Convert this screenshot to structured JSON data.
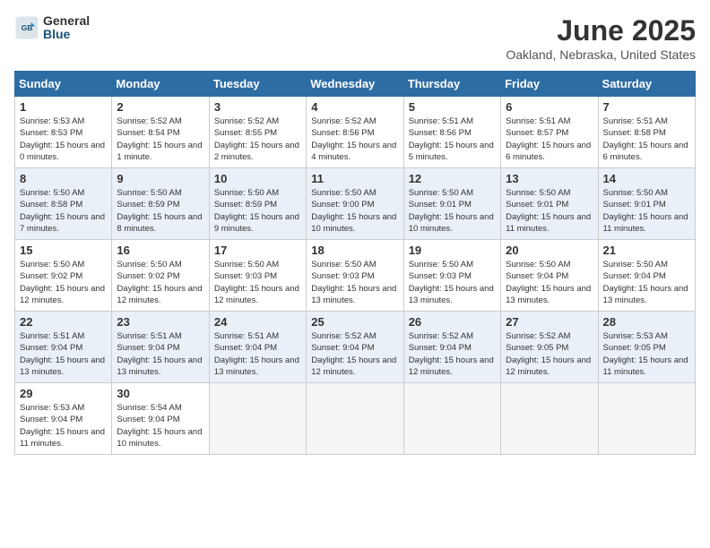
{
  "logo": {
    "general": "General",
    "blue": "Blue"
  },
  "title": "June 2025",
  "location": "Oakland, Nebraska, United States",
  "weekdays": [
    "Sunday",
    "Monday",
    "Tuesday",
    "Wednesday",
    "Thursday",
    "Friday",
    "Saturday"
  ],
  "weeks": [
    [
      {
        "day": "1",
        "sunrise": "Sunrise: 5:53 AM",
        "sunset": "Sunset: 8:53 PM",
        "daylight": "Daylight: 15 hours and 0 minutes."
      },
      {
        "day": "2",
        "sunrise": "Sunrise: 5:52 AM",
        "sunset": "Sunset: 8:54 PM",
        "daylight": "Daylight: 15 hours and 1 minute."
      },
      {
        "day": "3",
        "sunrise": "Sunrise: 5:52 AM",
        "sunset": "Sunset: 8:55 PM",
        "daylight": "Daylight: 15 hours and 2 minutes."
      },
      {
        "day": "4",
        "sunrise": "Sunrise: 5:52 AM",
        "sunset": "Sunset: 8:56 PM",
        "daylight": "Daylight: 15 hours and 4 minutes."
      },
      {
        "day": "5",
        "sunrise": "Sunrise: 5:51 AM",
        "sunset": "Sunset: 8:56 PM",
        "daylight": "Daylight: 15 hours and 5 minutes."
      },
      {
        "day": "6",
        "sunrise": "Sunrise: 5:51 AM",
        "sunset": "Sunset: 8:57 PM",
        "daylight": "Daylight: 15 hours and 6 minutes."
      },
      {
        "day": "7",
        "sunrise": "Sunrise: 5:51 AM",
        "sunset": "Sunset: 8:58 PM",
        "daylight": "Daylight: 15 hours and 6 minutes."
      }
    ],
    [
      {
        "day": "8",
        "sunrise": "Sunrise: 5:50 AM",
        "sunset": "Sunset: 8:58 PM",
        "daylight": "Daylight: 15 hours and 7 minutes."
      },
      {
        "day": "9",
        "sunrise": "Sunrise: 5:50 AM",
        "sunset": "Sunset: 8:59 PM",
        "daylight": "Daylight: 15 hours and 8 minutes."
      },
      {
        "day": "10",
        "sunrise": "Sunrise: 5:50 AM",
        "sunset": "Sunset: 8:59 PM",
        "daylight": "Daylight: 15 hours and 9 minutes."
      },
      {
        "day": "11",
        "sunrise": "Sunrise: 5:50 AM",
        "sunset": "Sunset: 9:00 PM",
        "daylight": "Daylight: 15 hours and 10 minutes."
      },
      {
        "day": "12",
        "sunrise": "Sunrise: 5:50 AM",
        "sunset": "Sunset: 9:01 PM",
        "daylight": "Daylight: 15 hours and 10 minutes."
      },
      {
        "day": "13",
        "sunrise": "Sunrise: 5:50 AM",
        "sunset": "Sunset: 9:01 PM",
        "daylight": "Daylight: 15 hours and 11 minutes."
      },
      {
        "day": "14",
        "sunrise": "Sunrise: 5:50 AM",
        "sunset": "Sunset: 9:01 PM",
        "daylight": "Daylight: 15 hours and 11 minutes."
      }
    ],
    [
      {
        "day": "15",
        "sunrise": "Sunrise: 5:50 AM",
        "sunset": "Sunset: 9:02 PM",
        "daylight": "Daylight: 15 hours and 12 minutes."
      },
      {
        "day": "16",
        "sunrise": "Sunrise: 5:50 AM",
        "sunset": "Sunset: 9:02 PM",
        "daylight": "Daylight: 15 hours and 12 minutes."
      },
      {
        "day": "17",
        "sunrise": "Sunrise: 5:50 AM",
        "sunset": "Sunset: 9:03 PM",
        "daylight": "Daylight: 15 hours and 12 minutes."
      },
      {
        "day": "18",
        "sunrise": "Sunrise: 5:50 AM",
        "sunset": "Sunset: 9:03 PM",
        "daylight": "Daylight: 15 hours and 13 minutes."
      },
      {
        "day": "19",
        "sunrise": "Sunrise: 5:50 AM",
        "sunset": "Sunset: 9:03 PM",
        "daylight": "Daylight: 15 hours and 13 minutes."
      },
      {
        "day": "20",
        "sunrise": "Sunrise: 5:50 AM",
        "sunset": "Sunset: 9:04 PM",
        "daylight": "Daylight: 15 hours and 13 minutes."
      },
      {
        "day": "21",
        "sunrise": "Sunrise: 5:50 AM",
        "sunset": "Sunset: 9:04 PM",
        "daylight": "Daylight: 15 hours and 13 minutes."
      }
    ],
    [
      {
        "day": "22",
        "sunrise": "Sunrise: 5:51 AM",
        "sunset": "Sunset: 9:04 PM",
        "daylight": "Daylight: 15 hours and 13 minutes."
      },
      {
        "day": "23",
        "sunrise": "Sunrise: 5:51 AM",
        "sunset": "Sunset: 9:04 PM",
        "daylight": "Daylight: 15 hours and 13 minutes."
      },
      {
        "day": "24",
        "sunrise": "Sunrise: 5:51 AM",
        "sunset": "Sunset: 9:04 PM",
        "daylight": "Daylight: 15 hours and 13 minutes."
      },
      {
        "day": "25",
        "sunrise": "Sunrise: 5:52 AM",
        "sunset": "Sunset: 9:04 PM",
        "daylight": "Daylight: 15 hours and 12 minutes."
      },
      {
        "day": "26",
        "sunrise": "Sunrise: 5:52 AM",
        "sunset": "Sunset: 9:04 PM",
        "daylight": "Daylight: 15 hours and 12 minutes."
      },
      {
        "day": "27",
        "sunrise": "Sunrise: 5:52 AM",
        "sunset": "Sunset: 9:05 PM",
        "daylight": "Daylight: 15 hours and 12 minutes."
      },
      {
        "day": "28",
        "sunrise": "Sunrise: 5:53 AM",
        "sunset": "Sunset: 9:05 PM",
        "daylight": "Daylight: 15 hours and 11 minutes."
      }
    ],
    [
      {
        "day": "29",
        "sunrise": "Sunrise: 5:53 AM",
        "sunset": "Sunset: 9:04 PM",
        "daylight": "Daylight: 15 hours and 11 minutes."
      },
      {
        "day": "30",
        "sunrise": "Sunrise: 5:54 AM",
        "sunset": "Sunset: 9:04 PM",
        "daylight": "Daylight: 15 hours and 10 minutes."
      },
      null,
      null,
      null,
      null,
      null
    ]
  ]
}
